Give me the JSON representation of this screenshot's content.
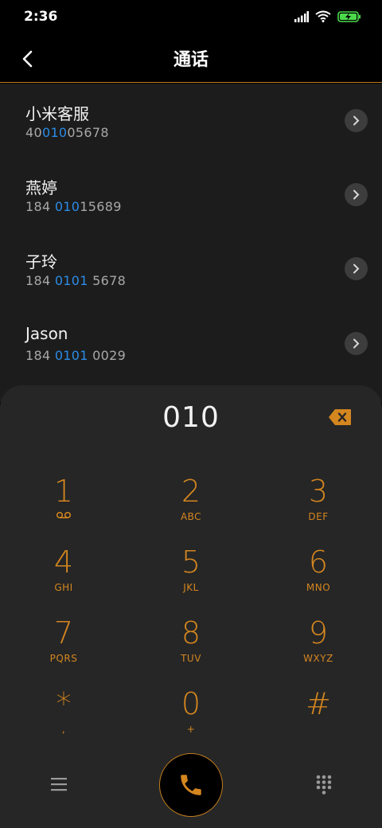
{
  "status_bar": {
    "time": "2:36"
  },
  "header": {
    "title": "通话"
  },
  "contacts": [
    {
      "name": "小米客服",
      "number_pre": "40",
      "number_hl": "010",
      "number_post": "05678"
    },
    {
      "name": "燕婷",
      "number_pre": "184 ",
      "number_hl": "010",
      "number_post": "15689"
    },
    {
      "name": "子玲",
      "number_pre": "184 ",
      "number_hl": "0101",
      "number_post": " 5678"
    },
    {
      "name": "Jason",
      "number_pre": "184 ",
      "number_hl": "0101",
      "number_post": " 0029"
    }
  ],
  "dialer": {
    "display": "010",
    "keys": [
      {
        "digit": "1",
        "letters": "",
        "sub_icon": "voicemail-icon"
      },
      {
        "digit": "2",
        "letters": "ABC"
      },
      {
        "digit": "3",
        "letters": "DEF"
      },
      {
        "digit": "4",
        "letters": "GHI"
      },
      {
        "digit": "5",
        "letters": "JKL"
      },
      {
        "digit": "6",
        "letters": "MNO"
      },
      {
        "digit": "7",
        "letters": "PQRS"
      },
      {
        "digit": "8",
        "letters": "TUV"
      },
      {
        "digit": "9",
        "letters": "WXYZ"
      },
      {
        "digit": "*",
        "letters": ","
      },
      {
        "digit": "0",
        "letters": "+"
      },
      {
        "digit": "#",
        "letters": ""
      }
    ]
  },
  "colors": {
    "accent": "#d4861f",
    "highlight": "#2b8be6",
    "list_bg": "#1c1c1c",
    "dialer_bg": "#262626"
  }
}
